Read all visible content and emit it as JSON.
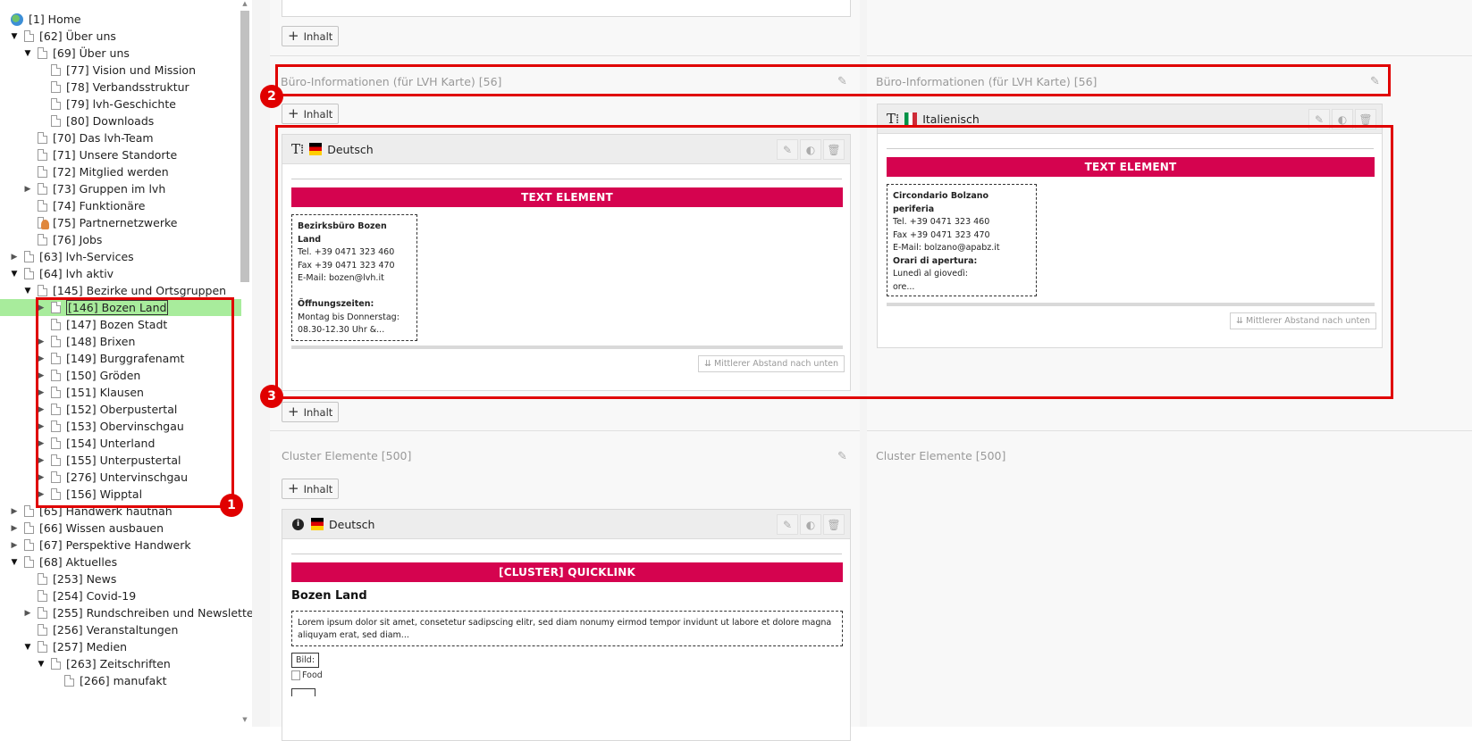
{
  "tree": {
    "rows": [
      {
        "label": "[1] Home",
        "level": 0,
        "toggle": "",
        "icon": "globe"
      },
      {
        "label": "[62] Über uns",
        "level": 1,
        "toggle": "open",
        "icon": "page"
      },
      {
        "label": "[69] Über uns",
        "level": 2,
        "toggle": "open",
        "icon": "page"
      },
      {
        "label": "[77] Vision und Mission",
        "level": 3,
        "toggle": "",
        "icon": "page"
      },
      {
        "label": "[78] Verbandsstruktur",
        "level": 3,
        "toggle": "",
        "icon": "page"
      },
      {
        "label": "[79] lvh-Geschichte",
        "level": 3,
        "toggle": "",
        "icon": "page"
      },
      {
        "label": "[80] Downloads",
        "level": 3,
        "toggle": "",
        "icon": "page"
      },
      {
        "label": "[70] Das lvh-Team",
        "level": 2,
        "toggle": "",
        "icon": "page"
      },
      {
        "label": "[71] Unsere Standorte",
        "level": 2,
        "toggle": "",
        "icon": "page"
      },
      {
        "label": "[72] Mitglied werden",
        "level": 2,
        "toggle": "",
        "icon": "page"
      },
      {
        "label": "[73] Gruppen im lvh",
        "level": 2,
        "toggle": "closed",
        "icon": "page"
      },
      {
        "label": "[74] Funktionäre",
        "level": 2,
        "toggle": "",
        "icon": "page"
      },
      {
        "label": "[75] Partnernetzwerke",
        "level": 2,
        "toggle": "",
        "icon": "person"
      },
      {
        "label": "[76] Jobs",
        "level": 2,
        "toggle": "",
        "icon": "page"
      },
      {
        "label": "[63] lvh-Services",
        "level": 1,
        "toggle": "closed",
        "icon": "page"
      },
      {
        "label": "[64] lvh aktiv",
        "level": 1,
        "toggle": "open",
        "icon": "page"
      },
      {
        "label": "[145] Bezirke und Ortsgruppen",
        "level": 2,
        "toggle": "open",
        "icon": "page"
      },
      {
        "label": "[146] Bozen Land",
        "level": 3,
        "toggle": "closed",
        "icon": "page",
        "selected": true
      },
      {
        "label": "[147] Bozen Stadt",
        "level": 3,
        "toggle": "",
        "icon": "page"
      },
      {
        "label": "[148] Brixen",
        "level": 3,
        "toggle": "closed",
        "icon": "page"
      },
      {
        "label": "[149] Burggrafenamt",
        "level": 3,
        "toggle": "closed",
        "icon": "page"
      },
      {
        "label": "[150] Gröden",
        "level": 3,
        "toggle": "closed",
        "icon": "page"
      },
      {
        "label": "[151] Klausen",
        "level": 3,
        "toggle": "closed",
        "icon": "page"
      },
      {
        "label": "[152] Oberpustertal",
        "level": 3,
        "toggle": "closed",
        "icon": "page"
      },
      {
        "label": "[153] Obervinschgau",
        "level": 3,
        "toggle": "closed",
        "icon": "page"
      },
      {
        "label": "[154] Unterland",
        "level": 3,
        "toggle": "closed",
        "icon": "page"
      },
      {
        "label": "[155] Unterpustertal",
        "level": 3,
        "toggle": "closed",
        "icon": "page"
      },
      {
        "label": "[276] Untervinschgau",
        "level": 3,
        "toggle": "closed",
        "icon": "page"
      },
      {
        "label": "[156] Wipptal",
        "level": 3,
        "toggle": "closed",
        "icon": "page"
      },
      {
        "label": "[65] Handwerk hautnah",
        "level": 1,
        "toggle": "closed",
        "icon": "page"
      },
      {
        "label": "[66] Wissen ausbauen",
        "level": 1,
        "toggle": "closed",
        "icon": "page"
      },
      {
        "label": "[67] Perspektive Handwerk",
        "level": 1,
        "toggle": "closed",
        "icon": "page"
      },
      {
        "label": "[68] Aktuelles",
        "level": 1,
        "toggle": "open",
        "icon": "page"
      },
      {
        "label": "[253] News",
        "level": 2,
        "toggle": "",
        "icon": "page"
      },
      {
        "label": "[254] Covid-19",
        "level": 2,
        "toggle": "",
        "icon": "page"
      },
      {
        "label": "[255] Rundschreiben und Newslette",
        "level": 2,
        "toggle": "closed",
        "icon": "page"
      },
      {
        "label": "[256] Veranstaltungen",
        "level": 2,
        "toggle": "",
        "icon": "page"
      },
      {
        "label": "[257] Medien",
        "level": 2,
        "toggle": "open",
        "icon": "page"
      },
      {
        "label": "[263] Zeitschriften",
        "level": 3,
        "toggle": "open",
        "icon": "page"
      },
      {
        "label": "[266] manufakt",
        "level": 4,
        "toggle": "",
        "icon": "page"
      }
    ]
  },
  "content": {
    "add_content_label": "Inhalt",
    "section_buero_de": "Büro-Informationen (für LVH Karte) [56]",
    "section_buero_it": "Büro-Informationen (für LVH Karte) [56]",
    "section_cluster_de": "Cluster Elemente [500]",
    "section_cluster_it": "Cluster Elemente [500]",
    "elem_de": {
      "language": "Deutsch",
      "type_banner": "TEXT ELEMENT",
      "title": "Bezirksbüro Bozen Land",
      "tel": "Tel. +39 0471 323 460",
      "fax": "Fax +39 0471 323 470",
      "email": "E-Mail: bozen@lvh.it",
      "hours_title": "Öffnungszeiten:",
      "hours_line1": "Montag bis Donnerstag:",
      "hours_line2": "08.30-12.30 Uhr &...",
      "spacing": "⇊ Mittlerer Abstand nach unten"
    },
    "elem_it": {
      "language": "Italienisch",
      "type_banner": "TEXT ELEMENT",
      "title": "Circondario Bolzano periferia",
      "tel": "Tel. +39 0471 323 460",
      "fax": "Fax +39 0471 323 470",
      "email": "E-Mail: bolzano@apabz.it",
      "hours_title": "Orari di apertura:",
      "hours_line1": "Lunedì al giovedì:",
      "hours_line2": "ore...",
      "spacing": "⇊ Mittlerer Abstand nach unten"
    },
    "cluster_de": {
      "language": "Deutsch",
      "type_banner": "[CLUSTER] QUICKLINK",
      "title": "Bozen Land",
      "lorem": "Lorem ipsum dolor sit amet, consetetur sadipscing elitr, sed diam nonumy eirmod tempor invidunt ut labore et dolore magna aliquyam erat, sed diam...",
      "bild_label": "Bild:",
      "img_alt": "Food"
    }
  },
  "annotations": [
    "1",
    "2",
    "3"
  ],
  "colors": {
    "accent_banner": "#d5034f",
    "annotation_red": "#e00000",
    "selected_row": "#a8ec9c"
  }
}
